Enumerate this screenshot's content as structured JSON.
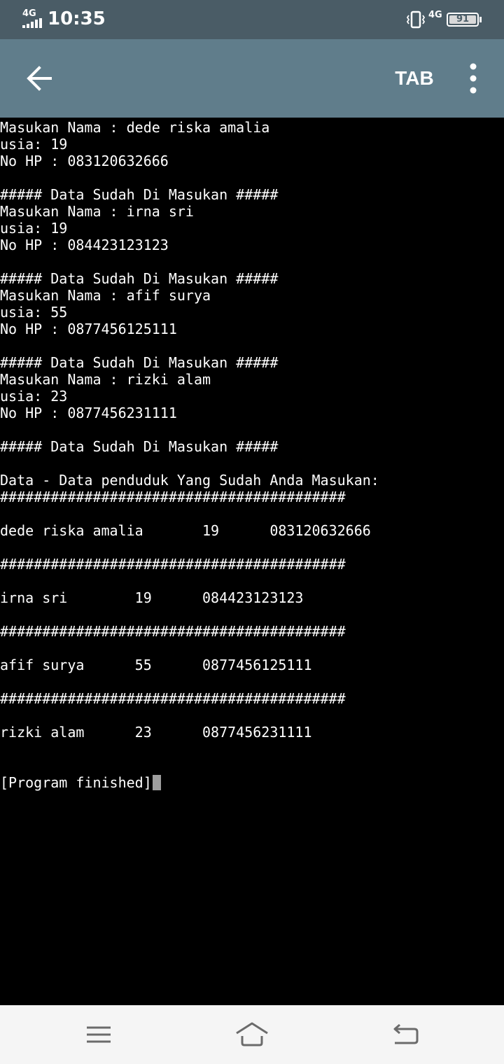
{
  "status_bar": {
    "network_left": "4G",
    "time": "10:35",
    "network_right": "4G",
    "battery_level": "91",
    "icons": [
      "signal-icon",
      "vibrate-icon",
      "battery-icon"
    ]
  },
  "app_bar": {
    "back_icon": "arrow-left-icon",
    "tab_label": "TAB",
    "menu_icon": "more-vertical-icon",
    "background_color": "#607d8b"
  },
  "terminal": {
    "lines": [
      "Masukan Nama : dede riska amalia",
      "usia: 19",
      "No HP : 083120632666",
      "",
      "##### Data Sudah Di Masukan #####",
      "Masukan Nama : irna sri",
      "usia: 19",
      "No HP : 084423123123",
      "",
      "##### Data Sudah Di Masukan #####",
      "Masukan Nama : afif surya",
      "usia: 55",
      "No HP : 0877456125111",
      "",
      "##### Data Sudah Di Masukan #####",
      "Masukan Nama : rizki alam",
      "usia: 23",
      "No HP : 0877456231111",
      "",
      "##### Data Sudah Di Masukan #####",
      "",
      "Data - Data penduduk Yang Sudah Anda Masukan:",
      "#########################################",
      "",
      "dede riska amalia       19      083120632666",
      "",
      "#########################################",
      "",
      "irna sri        19      084423123123",
      "",
      "#########################################",
      "",
      "afif surya      55      0877456125111",
      "",
      "#########################################",
      "",
      "rizki alam      23      0877456231111",
      "",
      "",
      "[Program finished]"
    ],
    "cursor_color": "#9e9e9e"
  },
  "nav_bar": {
    "icons": [
      "menu-lines-icon",
      "home-icon",
      "back-icon"
    ]
  }
}
